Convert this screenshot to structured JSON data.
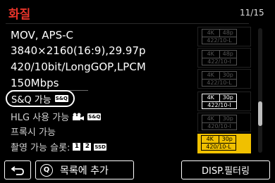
{
  "header": {
    "title": "화질",
    "page_counter": "11/15"
  },
  "scroll": {
    "position_fraction": 0.73,
    "visible_fraction": 0.2
  },
  "info": {
    "container": "MOV, APS-C",
    "resolution": "3840×2160(16:9),29.97p",
    "codec": "420/10bit/LongGOP,LPCM",
    "bitrate": "150Mbps",
    "sq_label": "S&Q 가능",
    "sq_icon_text": "S&Q",
    "hlg_label": "HLG 사용 가능",
    "hlg_icon_text": "S&Q",
    "proxy_label": "프록시 가능",
    "slot_label": "촬영 가능 슬롯:",
    "slot_1": "1",
    "slot_2": "2",
    "slot_ssd": "SSD"
  },
  "formats": [
    {
      "res": "4K",
      "fps": "48p",
      "spec": "422/10-L",
      "state": "inactive"
    },
    {
      "res": "4K",
      "fps": "48p",
      "spec": "422/10-I",
      "state": "inactive"
    },
    {
      "res": "4K",
      "fps": "30p",
      "spec": "422/10-L",
      "state": "inactive"
    },
    {
      "res": "4K",
      "fps": "30p",
      "spec": "422/10-I",
      "state": "active"
    },
    {
      "res": "4K",
      "fps": "30p",
      "spec": "420/10-I",
      "state": "inactive"
    },
    {
      "res": "4K",
      "fps": "30p",
      "spec": "420/10-L",
      "state": "selected"
    }
  ],
  "buttons": {
    "back_icon": "return-arrow-icon",
    "q_icon_text": "Q",
    "add_to_list": "목록에 추가",
    "filter": "DISP.필터링"
  },
  "colors": {
    "title": "#e8342a",
    "selected": "#f0c000"
  }
}
